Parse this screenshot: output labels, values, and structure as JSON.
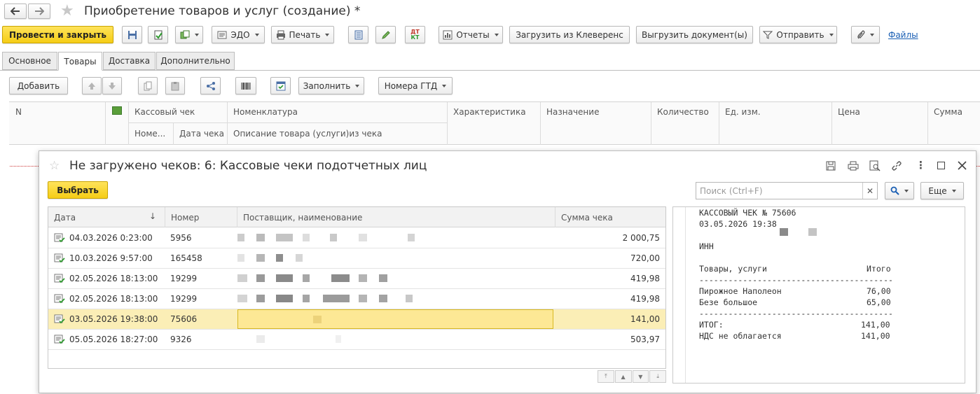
{
  "window": {
    "title": "Приобретение товаров и услуг (создание) *",
    "nav": {
      "back": "back-arrow",
      "forward": "forward-arrow",
      "favorite": "star"
    }
  },
  "toolbar": {
    "post_close": "Провести и закрыть",
    "edo": "ЭДО",
    "print": "Печать",
    "reports": "Отчеты",
    "load_kleverens": "Загрузить из Клеверенс",
    "unload_docs": "Выгрузить документ(ы)",
    "send": "Отправить",
    "files": "Файлы",
    "dt_kt": "ДТ КТ"
  },
  "tabs": [
    "Основное",
    "Товары",
    "Доставка",
    "Дополнительно"
  ],
  "active_tab": "Товары",
  "goods_toolbar": {
    "add": "Добавить",
    "fill": "Заполнить",
    "gtd": "Номера ГТД"
  },
  "goods_table": {
    "headers_top": [
      "N",
      "Кассовый чек",
      "Номенклатура",
      "Характеристика",
      "Назначение",
      "Количество",
      "Ед. изм.",
      "Цена",
      "Сумма"
    ],
    "headers_bottom": [
      "Номе...",
      "Дата чека",
      "Описание товара (услуги)из чека"
    ]
  },
  "dialog": {
    "title": "Не загружено чеков: 6: Кассовые чеки подотчетных лиц",
    "select": "Выбрать",
    "search_placeholder": "Поиск (Ctrl+F)",
    "more": "Еще",
    "columns": [
      "Дата",
      "Номер",
      "Поставщик, наименование",
      "Сумма чека"
    ],
    "rows": [
      {
        "date": "04.03.2026 0:23:00",
        "number": "5956",
        "sum": "2 000,75",
        "selected": false
      },
      {
        "date": "10.03.2026 9:57:00",
        "number": "165458",
        "sum": "720,00",
        "selected": false
      },
      {
        "date": "02.05.2026 18:13:00",
        "number": "19299",
        "sum": "419,98",
        "selected": false
      },
      {
        "date": "02.05.2026 18:13:00",
        "number": "19299",
        "sum": "419,98",
        "selected": false
      },
      {
        "date": "03.05.2026 19:38:00",
        "number": "75606",
        "sum": "141,00",
        "selected": true
      },
      {
        "date": "05.05.2026 18:27:00",
        "number": "9326",
        "sum": "503,97",
        "selected": false
      }
    ],
    "receipt": {
      "line1": "КАССОВЫЙ ЧЕК № 75606",
      "line2": "03.05.2026 19:38",
      "inn": "ИНН",
      "goods_header": "Товары, услуги",
      "total_header": "Итого",
      "separator": "----------------------------------------",
      "item1": "Пирожное Наполеон",
      "item1_sum": "76,00",
      "item2": "Безе большое",
      "item2_sum": "65,00",
      "itog": "ИТОГ:",
      "itog_sum": "141,00",
      "vat": "НДС не облагается",
      "vat_sum": "141,00"
    }
  },
  "colors": {
    "accent_yellow": "#f5cd16",
    "selected_row": "#fbeeb6",
    "link": "#1a5fb4"
  }
}
